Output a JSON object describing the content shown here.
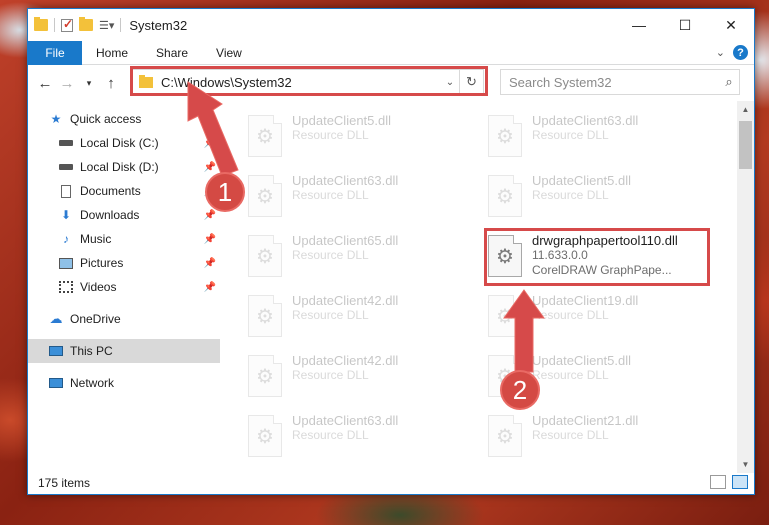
{
  "window": {
    "title": "System32",
    "controls": {
      "minimize": "—",
      "maximize": "☐",
      "close": "✕"
    }
  },
  "ribbon": {
    "file_tab": "File",
    "tabs": [
      "Home",
      "Share",
      "View"
    ],
    "help": "?"
  },
  "address": {
    "path": "C:\\Windows\\System32",
    "search_placeholder": "Search System32"
  },
  "nav": {
    "items": [
      {
        "label": "Quick access",
        "icon": "star-icon",
        "pinned": false
      },
      {
        "label": "Local Disk (C:)",
        "icon": "drive-icon",
        "pinned": true
      },
      {
        "label": "Local Disk (D:)",
        "icon": "drive-icon",
        "pinned": true
      },
      {
        "label": "Documents",
        "icon": "documents-icon",
        "pinned": true
      },
      {
        "label": "Downloads",
        "icon": "download-icon",
        "pinned": true
      },
      {
        "label": "Music",
        "icon": "music-icon",
        "pinned": true
      },
      {
        "label": "Pictures",
        "icon": "pictures-icon",
        "pinned": true
      },
      {
        "label": "Videos",
        "icon": "videos-icon",
        "pinned": true
      },
      {
        "label": "OneDrive",
        "icon": "cloud-icon",
        "pinned": false
      },
      {
        "label": "This PC",
        "icon": "computer-icon",
        "pinned": false,
        "selected": true
      },
      {
        "label": "Network",
        "icon": "network-icon",
        "pinned": false
      }
    ]
  },
  "files": {
    "left": [
      {
        "name": "UpdateClient5.dll",
        "sub": "Resource DLL"
      },
      {
        "name": "UpdateClient63.dll",
        "sub": "Resource DLL"
      },
      {
        "name": "UpdateClient65.dll",
        "sub": "Resource DLL"
      },
      {
        "name": "UpdateClient42.dll",
        "sub": "Resource DLL"
      },
      {
        "name": "UpdateClient42.dll",
        "sub": "Resource DLL"
      },
      {
        "name": "UpdateClient63.dll",
        "sub": "Resource DLL"
      }
    ],
    "right": [
      {
        "name": "UpdateClient63.dll",
        "sub": "Resource DLL"
      },
      {
        "name": "UpdateClient5.dll",
        "sub": "Resource DLL"
      },
      {
        "name": "drwgraphpapertool110.dll",
        "sub": "11.633.0.0",
        "sub2": "CorelDRAW GraphPape...",
        "highlighted": true
      },
      {
        "name": "UpdateClient19.dll",
        "sub": "Resource DLL"
      },
      {
        "name": "UpdateClient5.dll",
        "sub": "Resource DLL"
      },
      {
        "name": "UpdateClient21.dll",
        "sub": "Resource DLL"
      }
    ]
  },
  "status": {
    "item_count": "175 items"
  },
  "annotations": {
    "step1": "1",
    "step2": "2",
    "color": "#d64a4a"
  }
}
